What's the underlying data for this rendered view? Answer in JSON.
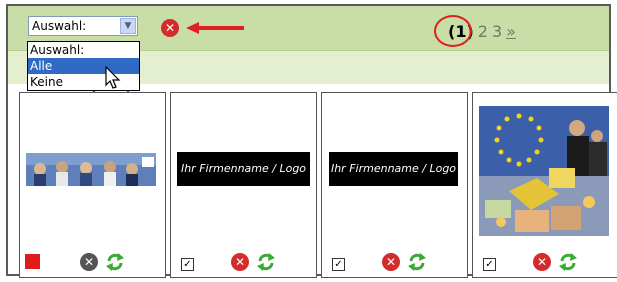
{
  "filter": {
    "selected": "Auswahl:",
    "options": [
      "Auswahl:",
      "Alle",
      "Keine"
    ]
  },
  "pager": {
    "current": "(1)",
    "pages": [
      "2",
      "3"
    ],
    "next": "»"
  },
  "cards": [
    {
      "image": "team-photo-banner",
      "checked": false,
      "marker": "red-square"
    },
    {
      "image": "logo-placeholder",
      "logo_text": "Ihr Firmenname / Logo",
      "checked": true
    },
    {
      "image": "logo-placeholder",
      "logo_text": "Ihr Firmenname / Logo",
      "checked": true
    },
    {
      "image": "euro-business-photo",
      "checked": true
    }
  ],
  "colors": {
    "header_bg": "#c9dea6",
    "subbar_bg": "#e4efd0",
    "highlight": "#e02020",
    "selected_option": "#316ac5",
    "delete_red": "#d42c2c",
    "refresh_green": "#3aaa35"
  },
  "icons": [
    "chevron-down-icon",
    "delete-icon",
    "arrow-left-icon",
    "refresh-icon",
    "cursor-icon"
  ]
}
